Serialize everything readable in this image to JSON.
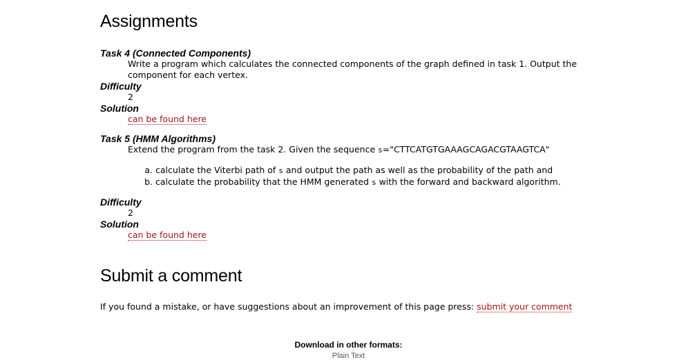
{
  "assignments": {
    "heading": "Assignments",
    "task4": {
      "title": "Task 4 (Connected Components)",
      "description": "Write a program which calculates the connected components of the graph defined in task 1. Output the component for each vertex.",
      "difficulty_label": "Difficulty",
      "difficulty_value": "2",
      "solution_label": "Solution",
      "solution_link": "can be found here"
    },
    "task5": {
      "title": "Task 5 (HMM Algorithms)",
      "description_pre": "Extend the program from the task 2. Given the sequence ",
      "var": "s",
      "description_post": "=\"CTTCATGTGAAAGCAGACGTAAGTCA\"",
      "item_a_pre": "calculate the Viterbi path of ",
      "item_a_var": "s",
      "item_a_post": " and output the path as well as the probability of the path and",
      "item_b_pre": "calculate the probability that the HMM generated ",
      "item_b_var": "s",
      "item_b_post": " with the forward and backward algorithm.",
      "difficulty_label": "Difficulty",
      "difficulty_value": "2",
      "solution_label": "Solution",
      "solution_link": "can be found here"
    }
  },
  "comment": {
    "heading": "Submit a comment",
    "text": "If you found a mistake, or have suggestions about an improvement of this page press: ",
    "link": "submit your comment"
  },
  "footer": {
    "title": "Download in other formats:",
    "formats": "Plain Text"
  }
}
